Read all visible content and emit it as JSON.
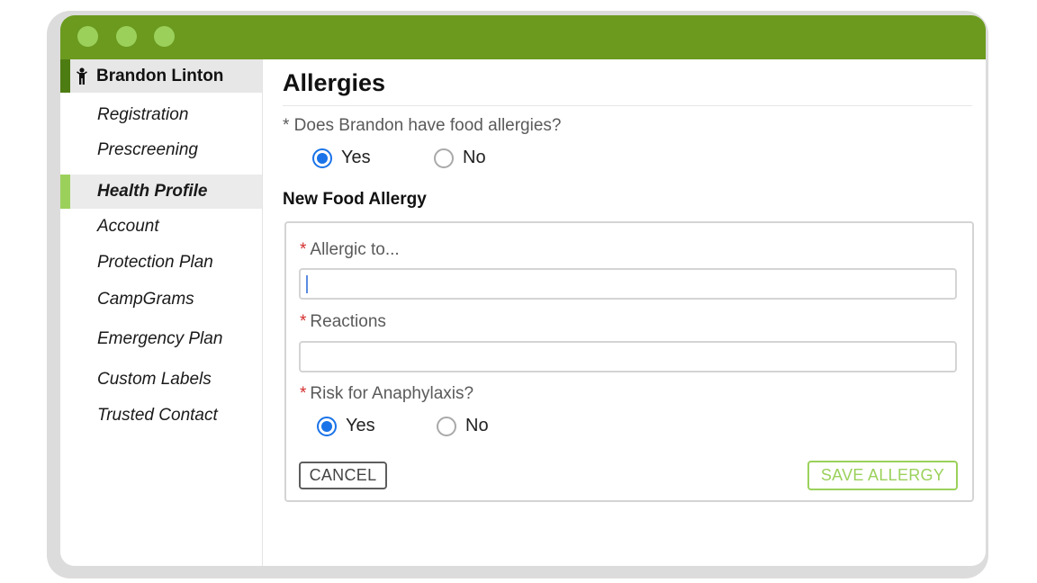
{
  "window": {
    "titlebar_color": "#6b9a1f",
    "dot_color": "#9bd15b"
  },
  "sidebar": {
    "user_icon": "person-icon",
    "user_name": "Brandon Linton",
    "items": [
      {
        "label": "Registration",
        "active": false
      },
      {
        "label": "Prescreening",
        "active": false
      },
      {
        "label": "Health Profile",
        "active": true
      },
      {
        "label": "Account",
        "active": false
      },
      {
        "label": "Protection Plan",
        "active": false
      },
      {
        "label": "CampGrams",
        "active": false
      },
      {
        "label": "Emergency Plan",
        "active": false
      },
      {
        "label": "Custom Labels",
        "active": false
      },
      {
        "label": "Trusted Contact",
        "active": false
      }
    ]
  },
  "main": {
    "title": "Allergies",
    "question": "* Does Brandon have food allergies?",
    "food_allergy_options": [
      {
        "label": "Yes",
        "selected": true
      },
      {
        "label": "No",
        "selected": false
      }
    ],
    "section_title": "New Food Allergy",
    "form": {
      "allergic_to": {
        "label": "Allergic to...",
        "value": ""
      },
      "reactions": {
        "label": "Reactions",
        "value": ""
      },
      "anaphylaxis": {
        "label": "Risk for Anaphylaxis?",
        "options": [
          {
            "label": "Yes",
            "selected": true
          },
          {
            "label": "No",
            "selected": false
          }
        ]
      },
      "required_marker": "*",
      "cancel_label": "CANCEL",
      "save_label": "SAVE ALLERGY"
    }
  }
}
